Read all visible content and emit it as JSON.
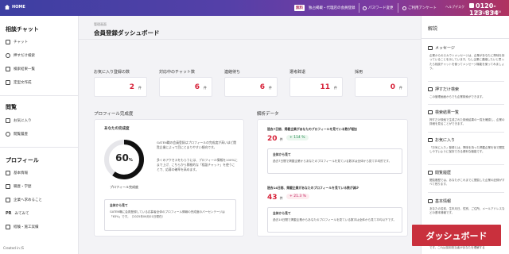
{
  "topbar": {
    "home_label": "HOME",
    "tag": "無料",
    "tag_text": "独占掲載・代理店の会員登録",
    "password_label": "パスワード変更",
    "survey_label": "ご利用アンケート",
    "help_label": "ヘルプデスク",
    "phone": "0120-123-834",
    "hours": "平日 10:00 〜 19:00"
  },
  "sidebar": {
    "consult_title": "相談チャット",
    "consult_items": [
      "チャット",
      "押すだけ検索",
      "検索結果一覧",
      "定型文作成"
    ],
    "browse_title": "閲覧",
    "browse_items": [
      "お気に入り",
      "閲覧履歴"
    ],
    "profile_title": "プロフィール",
    "profile_items": [
      "基本情報",
      "職歴・学歴",
      "企業へ求めること",
      "みてみて",
      "経験・施工実績"
    ],
    "pr_icon": "PR",
    "created": "Created in /S"
  },
  "main": {
    "breadcrumb": "管理画面",
    "title": "会員登録ダッシュボード",
    "stats": [
      {
        "label": "お気に入り登録の数",
        "value": "2",
        "unit": "件"
      },
      {
        "label": "対応中のチャット数",
        "value": "6",
        "unit": "件"
      },
      {
        "label": "連絡待ち",
        "value": "6",
        "unit": "件"
      },
      {
        "label": "選考辞退",
        "value": "11",
        "unit": "件"
      },
      {
        "label": "採用",
        "value": "0",
        "unit": "件"
      }
    ],
    "profile_panel": {
      "title": "プロフィール完成度",
      "sub_title": "あなたの完成度",
      "percent": 60,
      "percent_text": "60",
      "percent_sign": "%",
      "ring_label": "プロフィール完成度",
      "para1": "GATEN職の会員登録はプロフィールの完成度が高いほど閲覧企業によって目にとまりやすい傾向です。",
      "para2": "多くのアクセスをもらうには、プロフィール情報を100%にまで上げ、こちらから積極的な「相談チャット」を使うことで、応募の確率を高めます。",
      "tip_head": "全体から見て",
      "tip_body": "GATEN職に会員登録している応募者全体のプロフィール情報の完成度のパーセンテージは「63%」です。（2025年06月01日現在）"
    },
    "analysis_panel": {
      "title": "解析データ",
      "m1_title": "過去7日間、掲載企業があなたのプロフィールを見ている数が増加",
      "m1_value": "20",
      "m1_unit": "件",
      "m1_delta": "+ 114 %",
      "m1_box_head": "全体から見て",
      "m1_box_body": "過去7日間で掲載企業からあなたのプロフィールを見ている数字は全体から見て平均的です。",
      "m2_title": "過去14日間、掲載企業があなたのプロフィールを見ている数が減少",
      "m2_value": "43",
      "m2_unit": "件",
      "m2_delta": "+ 21.3 %",
      "m2_box_head": "全体から見て",
      "m2_box_body": "過去14日間で掲載企業からあなたのプロフィールを見ている数字は全体から見て平均以下です。"
    }
  },
  "right": {
    "title": "解説",
    "sections": [
      {
        "head": "メッセージ",
        "body": "企業からのスカウトメッセージは、企業があなたに興味を持っていることを示しています。もし企業に連絡したいと思ったら相談チャットを使ってメッセージ機能を使ってみましょう。"
      },
      {
        "head": "押すだけ検索",
        "body": "この管理画面からでも企業検索ができます。"
      },
      {
        "head": "検索結果一覧",
        "body": "押すだけ検索で生成された検索結果の一覧を確認し、企業の詳細を見ることができます。"
      },
      {
        "head": "お気に入り",
        "body": "「お気に入り」登録とは、興味を持った掲載企業を後で閲覧しやすいように保存できる便利な機能です。"
      },
      {
        "head": "閲覧履歴",
        "body": "閲覧履歴では、あなたがこれまでに閲覧した企業の記録がすべて残ります。"
      },
      {
        "head": "基本情報",
        "body": "あなたの名前、生年月日、性別、ご住所、メールアドレスなどの基本情報です。"
      }
    ],
    "footer_text": "です。これは採用担当者があなたを理解する"
  },
  "dashboard_button": "ダッシュボード",
  "colors": {
    "accent": "#d7233a",
    "button": "#c9303d",
    "topbar_start": "#3d3fa2",
    "topbar_end": "#b0325f",
    "ring": "#111111"
  }
}
